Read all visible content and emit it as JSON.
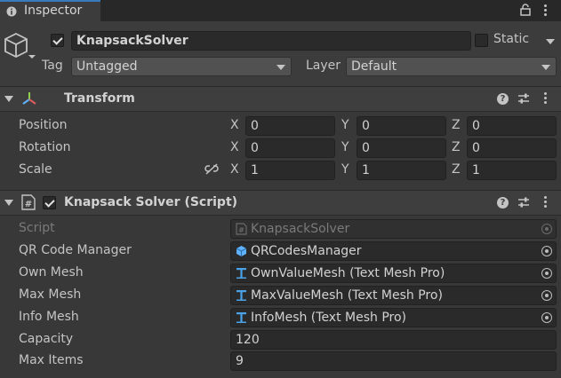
{
  "tab": {
    "title": "Inspector"
  },
  "gameobject": {
    "name": "KnapsackSolver",
    "active": true,
    "static_label": "Static",
    "tag_label": "Tag",
    "tag_value": "Untagged",
    "layer_label": "Layer",
    "layer_value": "Default"
  },
  "transform": {
    "title": "Transform",
    "rows": [
      {
        "label": "Position",
        "x": "0",
        "y": "0",
        "z": "0"
      },
      {
        "label": "Rotation",
        "x": "0",
        "y": "0",
        "z": "0"
      },
      {
        "label": "Scale",
        "x": "1",
        "y": "1",
        "z": "1"
      }
    ],
    "axes": [
      "X",
      "Y",
      "Z"
    ]
  },
  "script_component": {
    "title": "Knapsack Solver (Script)",
    "enabled": true,
    "fields": [
      {
        "label": "Script",
        "value": "KnapsackSolver",
        "icon": "script-icon"
      },
      {
        "label": "QR Code Manager",
        "value": "QRCodesManager",
        "icon": "cube-icon"
      },
      {
        "label": "Own Mesh",
        "value": "OwnValueMesh (Text Mesh Pro)",
        "icon": "text-mesh-pro-icon"
      },
      {
        "label": "Max Mesh",
        "value": "MaxValueMesh (Text Mesh Pro)",
        "icon": "text-mesh-pro-icon"
      },
      {
        "label": "Info Mesh",
        "value": "InfoMesh (Text Mesh Pro)",
        "icon": "text-mesh-pro-icon"
      },
      {
        "label": "Capacity",
        "value": "120"
      },
      {
        "label": "Max Items",
        "value": "9"
      }
    ]
  },
  "colors": {
    "accent": "#3a79bb",
    "tmp_icon": "#4aa3e8",
    "cube_icon": "#5fb2ff"
  }
}
